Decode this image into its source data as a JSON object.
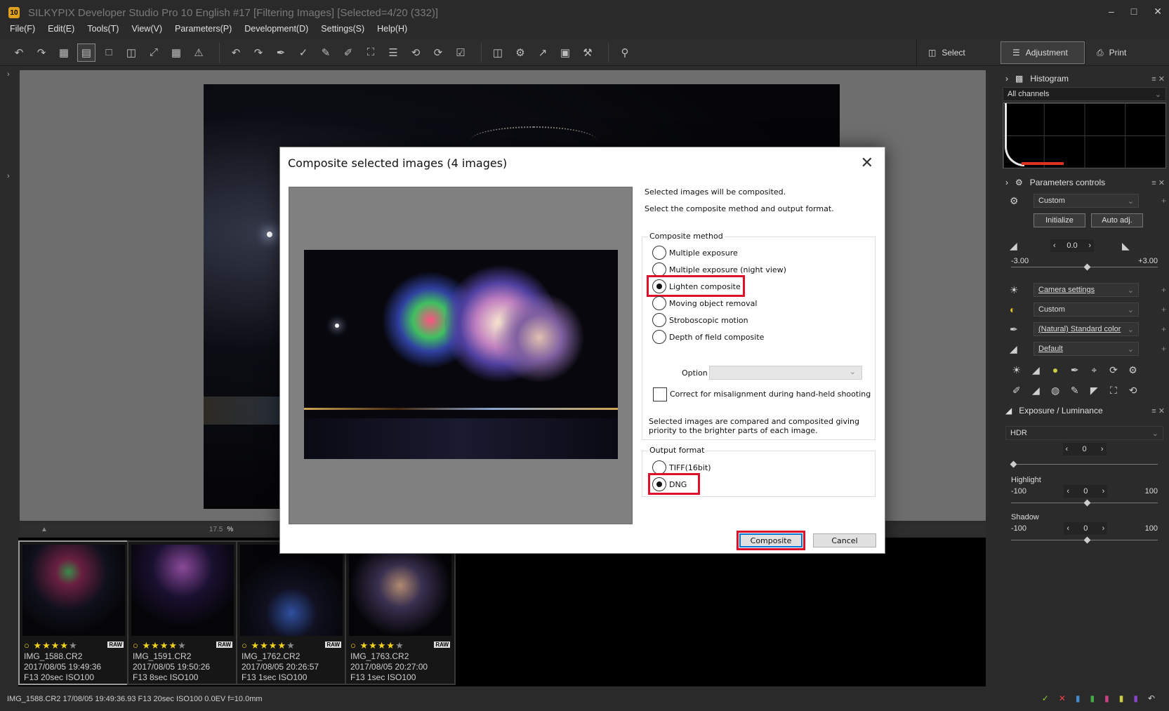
{
  "window": {
    "title": "SILKYPIX Developer Studio Pro 10 English   #17 [Filtering Images]   [Selected=4/20 (332)]",
    "logo": "10"
  },
  "menu": [
    "File(F)",
    "Edit(E)",
    "Tools(T)",
    "View(V)",
    "Parameters(P)",
    "Development(D)",
    "Settings(S)",
    "Help(H)"
  ],
  "mode_tabs": {
    "select": "Select",
    "adjustment": "Adjustment",
    "print": "Print"
  },
  "zoom": {
    "value": "17.5",
    "unit": "%"
  },
  "thumbnails": [
    {
      "name": "IMG_1588.CR2",
      "date": "2017/08/05 19:49:36",
      "exposure": "F13 20sec ISO100",
      "rating": 4,
      "badge": "RAW"
    },
    {
      "name": "IMG_1591.CR2",
      "date": "2017/08/05 19:50:26",
      "exposure": "F13 8sec ISO100",
      "rating": 4,
      "badge": "RAW"
    },
    {
      "name": "IMG_1762.CR2",
      "date": "2017/08/05 20:26:57",
      "exposure": "F13 1sec ISO100",
      "rating": 4,
      "badge": "RAW"
    },
    {
      "name": "IMG_1763.CR2",
      "date": "2017/08/05 20:27:00",
      "exposure": "F13 1sec ISO100",
      "rating": 4,
      "badge": "RAW"
    }
  ],
  "status": {
    "text": "IMG_1588.CR2 17/08/05 19:49:36.93 F13 20sec ISO100  0.0EV f=10.0mm"
  },
  "panel": {
    "histogram": {
      "title": "Histogram",
      "channel": "All channels"
    },
    "params": {
      "title": "Parameters controls",
      "preset": "Custom",
      "initialize": "Initialize",
      "auto_adj": "Auto adj.",
      "exposure_value": "0.0",
      "exposure_min": "-3.00",
      "exposure_max": "+3.00",
      "wb": "Camera settings",
      "tone": "Custom",
      "color": "(Natural) Standard color",
      "sharp": "Default"
    },
    "exposure_lum": {
      "title": "Exposure / Luminance",
      "mode": "HDR",
      "hdr_value": "0",
      "highlight_label": "Highlight",
      "highlight_min": "-100",
      "highlight_value": "0",
      "highlight_max": "100",
      "shadow_label": "Shadow",
      "shadow_min": "-100",
      "shadow_value": "0",
      "shadow_max": "100"
    }
  },
  "dialog": {
    "title": "Composite selected images (4 images)",
    "msg1": "Selected images will be composited.",
    "msg2": "Select the composite method and output format.",
    "method_label": "Composite method",
    "methods": [
      "Multiple exposure",
      "Multiple exposure (night view)",
      "Lighten composite",
      "Moving object removal",
      "Stroboscopic motion",
      "Depth of field composite"
    ],
    "method_selected": "Lighten composite",
    "option_label": "Option",
    "misalign_label": "Correct for misalignment during hand-held shooting",
    "description": "Selected images are compared and composited giving priority to the brighter parts of each image.",
    "output_label": "Output format",
    "outputs": [
      "TIFF(16bit)",
      "DNG"
    ],
    "output_selected": "DNG",
    "composite_btn": "Composite",
    "cancel_btn": "Cancel",
    "highlight_color": "#e0102a"
  }
}
